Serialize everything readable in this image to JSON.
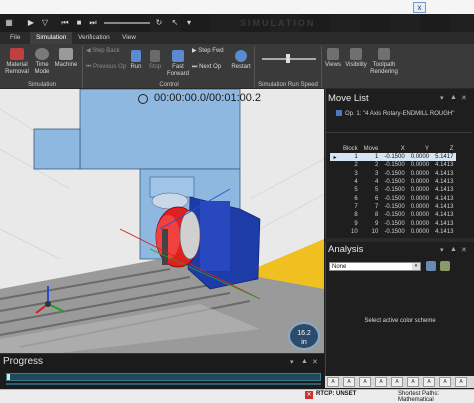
{
  "window": {
    "close_label": "x",
    "brand_text": "SIMULATION"
  },
  "quick_access": {
    "icons": [
      "menu-icon",
      "play-icon",
      "step-back-icon",
      "rewind-icon",
      "stop-icon",
      "fast-forward-icon",
      "loop-icon",
      "pointer-icon",
      "open-icon"
    ]
  },
  "tabs": [
    "File",
    "Simulation",
    "Verification",
    "View"
  ],
  "active_tab": "Simulation",
  "ribbon": {
    "simulation_group": {
      "label": "Simulation",
      "buttons": [
        "Material Removal",
        "Time Mode",
        "Machine"
      ]
    },
    "control_group": {
      "label": "Control",
      "step_back": "Step Back",
      "previous_op": "Previous Op",
      "run": "Run",
      "stop": "Stop",
      "fast_forward": "Fast Forward",
      "step_fwd": "Step Fwd",
      "next_op": "Next Op",
      "restart": "Restart"
    },
    "speed_group": {
      "label": "Simulation Run Speed"
    },
    "view_group": {
      "views": "Views",
      "visibility": "Visibility",
      "toolpath_rendering": "Toolpath Rendering"
    }
  },
  "viewport": {
    "timer": "00:00:00.0/00:01:00.2",
    "scale_value": "16.2",
    "scale_unit": "in"
  },
  "move_list": {
    "title": "Move List",
    "operation": "Op. 1: \"4 Axis Rotary-ENDMILL ROUGH\"",
    "headers": [
      "Block",
      "Move",
      "X",
      "Y",
      "Z"
    ],
    "rows": [
      [
        "1",
        "1",
        "-0.1500",
        "0.0000",
        "5.1417"
      ],
      [
        "2",
        "2",
        "-0.1500",
        "0.0000",
        "4.1413"
      ],
      [
        "3",
        "3",
        "-0.1500",
        "0.0000",
        "4.1413"
      ],
      [
        "4",
        "4",
        "-0.1500",
        "0.0000",
        "4.1413"
      ],
      [
        "5",
        "5",
        "-0.1500",
        "0.0000",
        "4.1413"
      ],
      [
        "6",
        "6",
        "-0.1500",
        "0.0000",
        "4.1413"
      ],
      [
        "7",
        "7",
        "-0.1500",
        "0.0000",
        "4.1413"
      ],
      [
        "8",
        "8",
        "-0.1500",
        "0.0000",
        "4.1413"
      ],
      [
        "9",
        "9",
        "-0.1500",
        "0.0000",
        "4.1413"
      ],
      [
        "10",
        "10",
        "-0.1500",
        "0.0000",
        "4.1413"
      ]
    ],
    "selected_row": 0
  },
  "analysis": {
    "title": "Analysis",
    "color_scheme": "None",
    "message": "Select active color scheme"
  },
  "progress": {
    "title": "Progress",
    "fraction": 0.01
  },
  "bottom_tabs": [
    "A",
    "A",
    "A",
    "A",
    "A",
    "A",
    "A",
    "A",
    "A"
  ],
  "status": {
    "rtcp": "RTCP: UNSET",
    "shortest_path": "Shortest Paths: Mathematical"
  },
  "colors": {
    "spindle_head": "#8fb8e0",
    "rotary_blue": "#1e3ca8",
    "chuck_red": "#e02020",
    "table_gray": "#9a9a9a",
    "fixture_yellow": "#f0c020"
  }
}
